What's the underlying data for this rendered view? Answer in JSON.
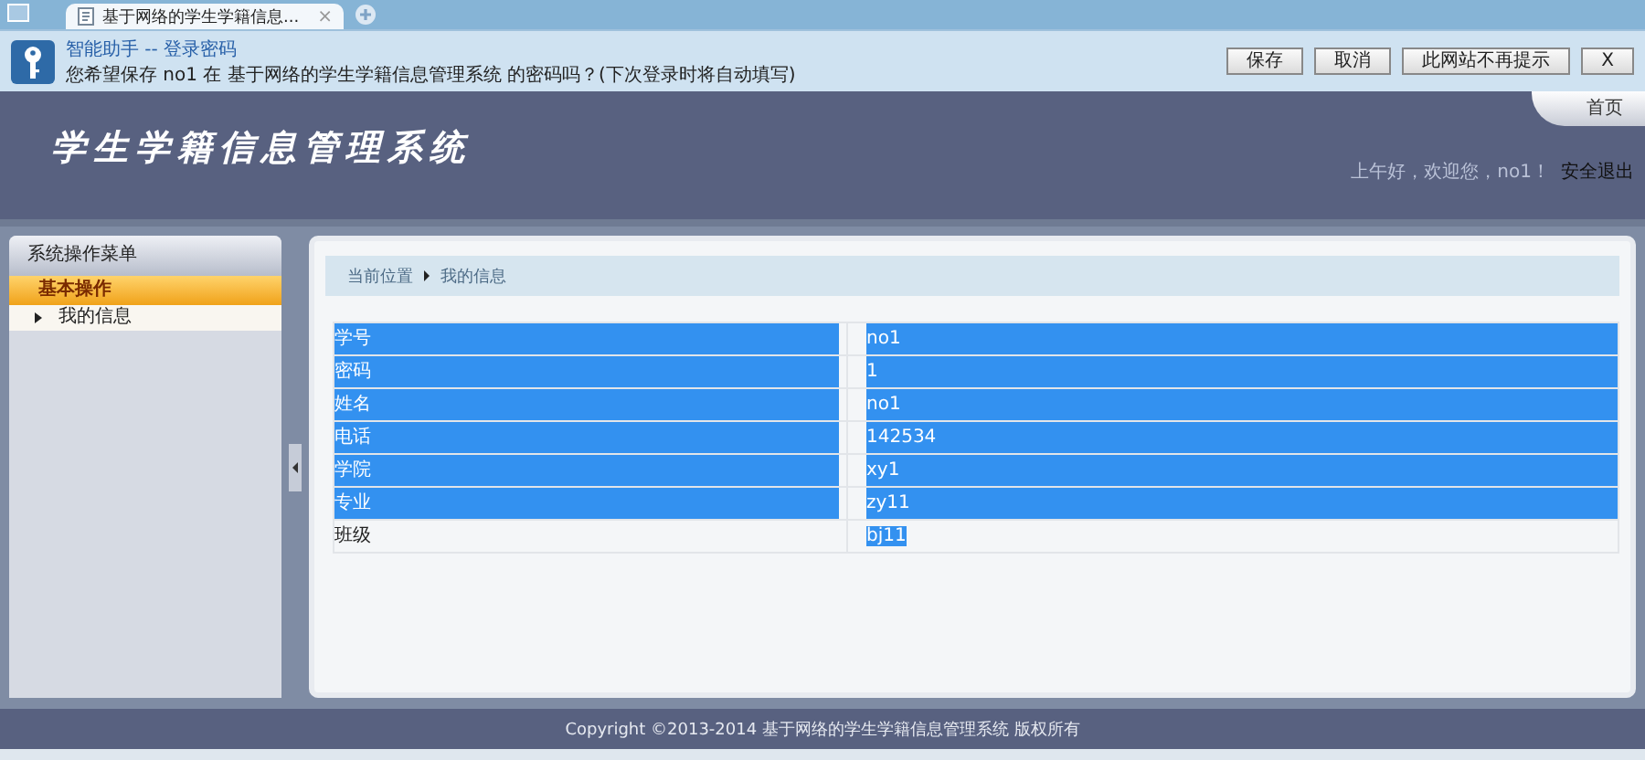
{
  "browser_tab": {
    "title": "基于网络的学生学籍信息...",
    "close": "×"
  },
  "notification": {
    "title": "智能助手 -- 登录密码",
    "message": "您希望保存 no1 在 基于网络的学生学籍信息管理系统 的密码吗？(下次登录时将自动填写)",
    "buttons": [
      "保存",
      "取消",
      "此网站不再提示"
    ],
    "close": "X"
  },
  "header": {
    "logo": "学生学籍信息管理系统",
    "home_tab": "首页",
    "greeting": "上午好，欢迎您，no1！",
    "logout": "安全退出"
  },
  "sidebar": {
    "title": "系统操作菜单",
    "groups": [
      {
        "label": "基本操作",
        "expanded": true,
        "items": [
          {
            "label": "我的信息",
            "selected": false
          }
        ]
      }
    ]
  },
  "breadcrumb": [
    "当前位置",
    "我的信息"
  ],
  "table": {
    "rows": [
      {
        "label": "学号",
        "value": "no1",
        "selected": true
      },
      {
        "label": "密码",
        "value": "1",
        "selected": true
      },
      {
        "label": "姓名",
        "value": "no1",
        "selected": true
      },
      {
        "label": "电话",
        "value": "142534",
        "selected": true
      },
      {
        "label": "学院",
        "value": "xy1",
        "selected": true
      },
      {
        "label": "专业",
        "value": "zy11",
        "selected": true
      },
      {
        "label": "班级",
        "value": "bj11",
        "selected": false
      }
    ]
  },
  "footer": "Copyright ©2013-2014 基于网络的学生学籍信息管理系统 版权所有"
}
